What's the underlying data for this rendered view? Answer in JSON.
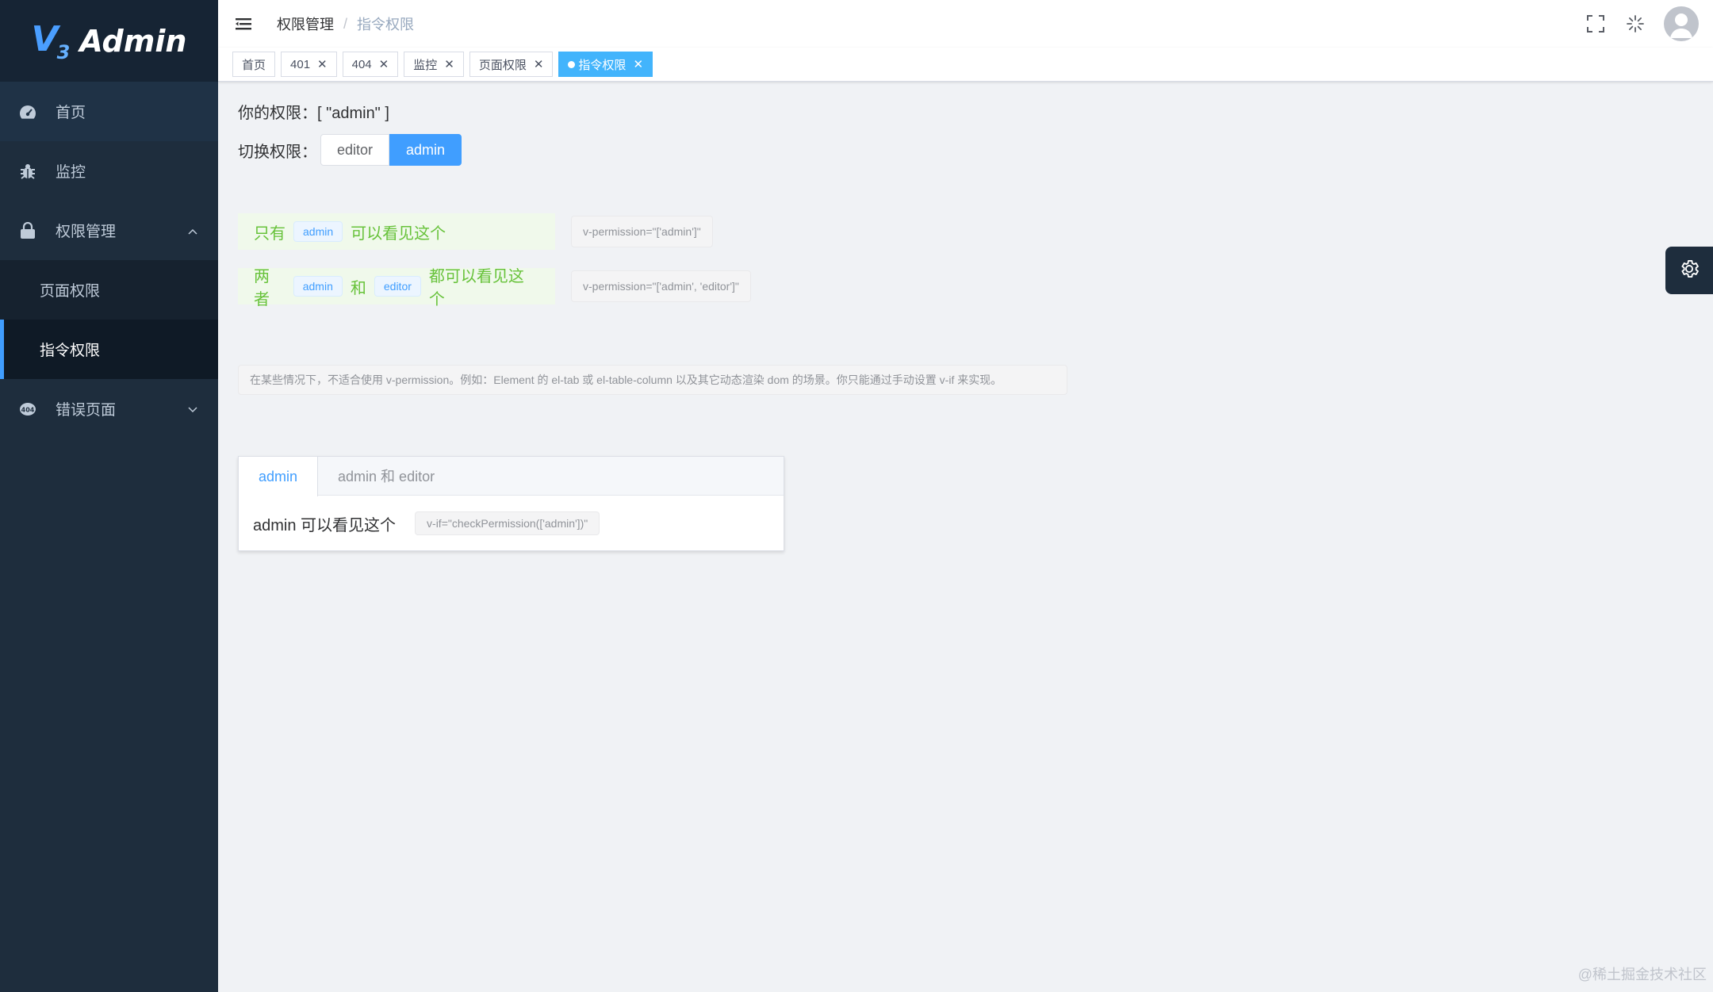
{
  "app": {
    "logo_mark": "V",
    "logo_sub": "3",
    "logo_text": "Admin"
  },
  "sidebar": {
    "items": [
      {
        "label": "首页",
        "icon": "dashboard-icon"
      },
      {
        "label": "监控",
        "icon": "bug-icon"
      },
      {
        "label": "权限管理",
        "icon": "lock-icon",
        "expanded": true,
        "children": [
          {
            "label": "页面权限"
          },
          {
            "label": "指令权限",
            "selected": true
          }
        ]
      },
      {
        "label": "错误页面",
        "icon": "404-icon",
        "expanded": false
      }
    ]
  },
  "navbar": {
    "breadcrumb": [
      "权限管理",
      "指令权限"
    ],
    "separator": "/"
  },
  "tags": [
    {
      "label": "首页",
      "closable": false
    },
    {
      "label": "401",
      "closable": true
    },
    {
      "label": "404",
      "closable": true
    },
    {
      "label": "监控",
      "closable": true
    },
    {
      "label": "页面权限",
      "closable": true
    },
    {
      "label": "指令权限",
      "closable": true,
      "active": true
    }
  ],
  "main": {
    "perm_label": "你的权限：",
    "perm_value": "[ \"admin\" ]",
    "switch_label": "切换权限：",
    "switch_options": [
      "editor",
      "admin"
    ],
    "switch_selected": "admin",
    "demo1": {
      "prefix": "只有",
      "tag": "admin",
      "suffix": "可以看见这个",
      "code": "v-permission=\"['admin']\""
    },
    "demo2": {
      "prefix": "两者",
      "tag1": "admin",
      "middle": "和",
      "tag2": "editor",
      "suffix": "都可以看见这个",
      "code": "v-permission=\"['admin', 'editor']\""
    },
    "info": "在某些情况下，不适合使用 v-permission。例如：Element 的 el-tab 或 el-table-column 以及其它动态渲染 dom 的场景。你只能通过手动设置 v-if 来实现。",
    "tabs": [
      {
        "label": "admin",
        "active": true
      },
      {
        "label": "admin 和 editor",
        "active": false
      }
    ],
    "tab_content": {
      "text": "admin 可以看见这个",
      "code": "v-if=\"checkPermission(['admin'])\""
    }
  },
  "watermark": "@稀土掘金技术社区",
  "colors": {
    "primary": "#409eff",
    "sidebar_bg": "#1e2d3d",
    "success": "#67c23a",
    "tag_active": "#42b4fc"
  }
}
